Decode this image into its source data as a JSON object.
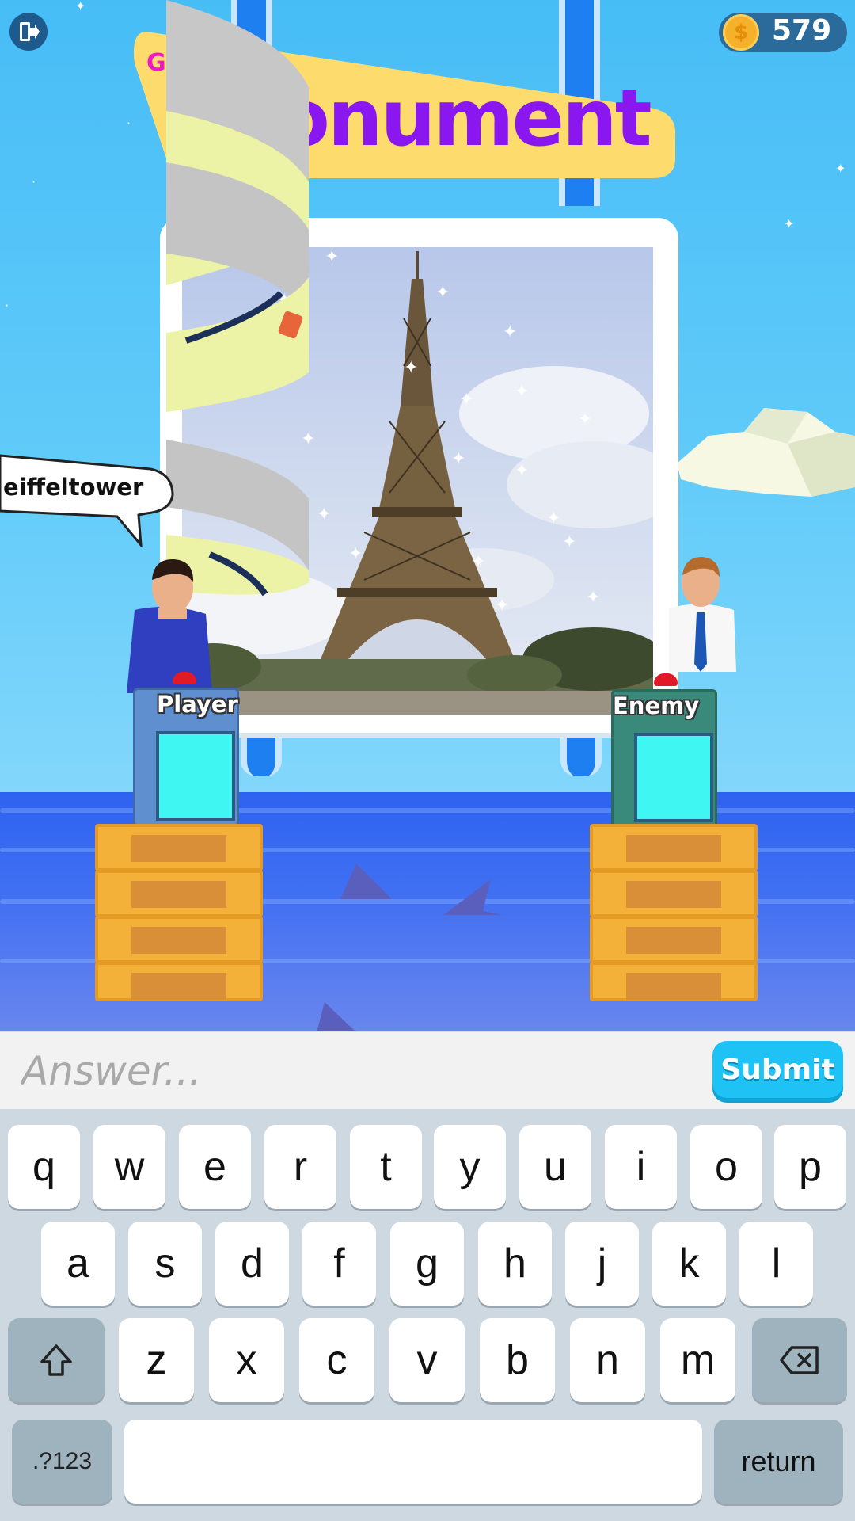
{
  "hud": {
    "coins": "579",
    "coin_symbol": "$"
  },
  "category": {
    "subtitle": "G      ...",
    "title": "Monument"
  },
  "speech_bubble": {
    "text": "eiffeltower"
  },
  "podiums": {
    "player_label": "Player",
    "enemy_label": "Enemy"
  },
  "answer": {
    "placeholder": "Answer...",
    "value": "",
    "submit_label": "Submit"
  },
  "keyboard": {
    "row1": [
      "q",
      "w",
      "e",
      "r",
      "t",
      "y",
      "u",
      "i",
      "o",
      "p"
    ],
    "row2": [
      "a",
      "s",
      "d",
      "f",
      "g",
      "h",
      "j",
      "k",
      "l"
    ],
    "row3": [
      "z",
      "x",
      "c",
      "v",
      "b",
      "n",
      "m"
    ],
    "shift_icon": "shift-icon",
    "backspace_icon": "backspace-icon",
    "numbers_label": ".?123",
    "space_label": "",
    "return_label": "return"
  },
  "colors": {
    "category_title": "#8a17f0",
    "category_subtitle": "#f318c5",
    "banner": "#fddb6d",
    "submit": "#1fc2f4",
    "podium_screen": "#3ff6f2"
  }
}
